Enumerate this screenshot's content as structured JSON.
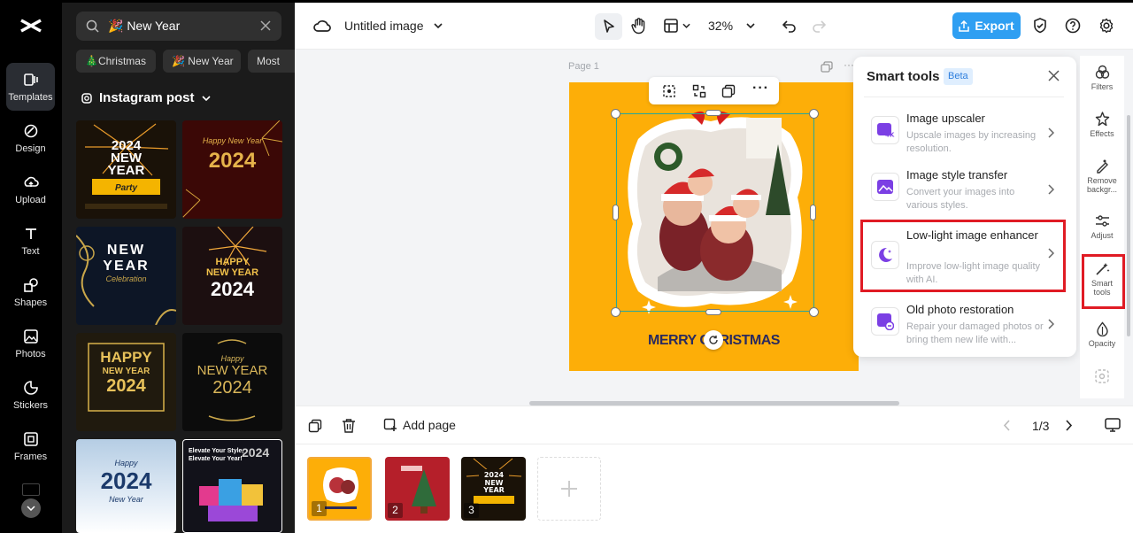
{
  "left_rail": {
    "items": [
      {
        "label": "Templates",
        "icon": "templates-icon"
      },
      {
        "label": "Design",
        "icon": "design-icon"
      },
      {
        "label": "Upload",
        "icon": "upload-icon"
      },
      {
        "label": "Text",
        "icon": "text-icon"
      },
      {
        "label": "Shapes",
        "icon": "shapes-icon"
      },
      {
        "label": "Photos",
        "icon": "photos-icon"
      },
      {
        "label": "Stickers",
        "icon": "stickers-icon"
      },
      {
        "label": "Frames",
        "icon": "frames-icon"
      }
    ]
  },
  "panel": {
    "search_value": "🎉 New Year",
    "chips": [
      "🎄Christmas",
      "🎉 New Year",
      "Most"
    ],
    "section_title": "Instagram post",
    "thumbs": [
      {
        "lines": [
          "2024",
          "NEW",
          "YEAR",
          "Party"
        ],
        "bg": "#1a1208"
      },
      {
        "lines": [
          "Happy New Year",
          "2024"
        ],
        "bg": "#3b0806"
      },
      {
        "lines": [
          "NEW",
          "YEAR",
          "Celebration"
        ],
        "bg": "#0d1626"
      },
      {
        "lines": [
          "HAPPY",
          "NEW YEAR",
          "2024"
        ],
        "bg": "#1c0f10"
      },
      {
        "lines": [
          "HAPPY",
          "NEW YEAR",
          "2024"
        ],
        "bg": "#201a0e"
      },
      {
        "lines": [
          "Happy",
          "NEW YEAR",
          "2024"
        ],
        "bg": "#0c0c0c"
      },
      {
        "lines": [
          "Happy",
          "2024",
          "New Year"
        ],
        "bg": "#cfe0ef"
      },
      {
        "lines": [
          "Elevate Your Style,",
          "Elevate Your Year!",
          "2024"
        ],
        "bg": "#12121a"
      }
    ]
  },
  "topbar": {
    "doc_title": "Untitled image",
    "zoom": "32%",
    "export_label": "Export"
  },
  "canvas": {
    "page_label": "Page 1",
    "design_text": "MERRY CHRISTMAS"
  },
  "smart_tools": {
    "title": "Smart tools",
    "badge": "Beta",
    "tools": [
      {
        "name": "Image upscaler",
        "desc": "Upscale images by increasing resolution.",
        "icon": "upscale-4k-icon"
      },
      {
        "name": "Image style transfer",
        "desc": "Convert your images into various styles.",
        "icon": "style-transfer-icon"
      },
      {
        "name": "Low-light image enhancer",
        "desc": "Improve low-light image quality with AI.",
        "icon": "low-light-moon-icon"
      },
      {
        "name": "Old photo restoration",
        "desc": "Repair your damaged photos or bring them new life with...",
        "icon": "photo-restore-icon"
      }
    ]
  },
  "right_rail": {
    "items": [
      "Filters",
      "Effects",
      "Remove backgr...",
      "Adjust",
      "Smart tools",
      "Opacity"
    ]
  },
  "bottom": {
    "add_page": "Add page",
    "pager": "1/3",
    "page_thumbs": [
      "1",
      "2",
      "3"
    ]
  },
  "colors": {
    "accent": "#2f9ff2",
    "highlight": "#e01b24",
    "page_bg": "#fdae08"
  }
}
